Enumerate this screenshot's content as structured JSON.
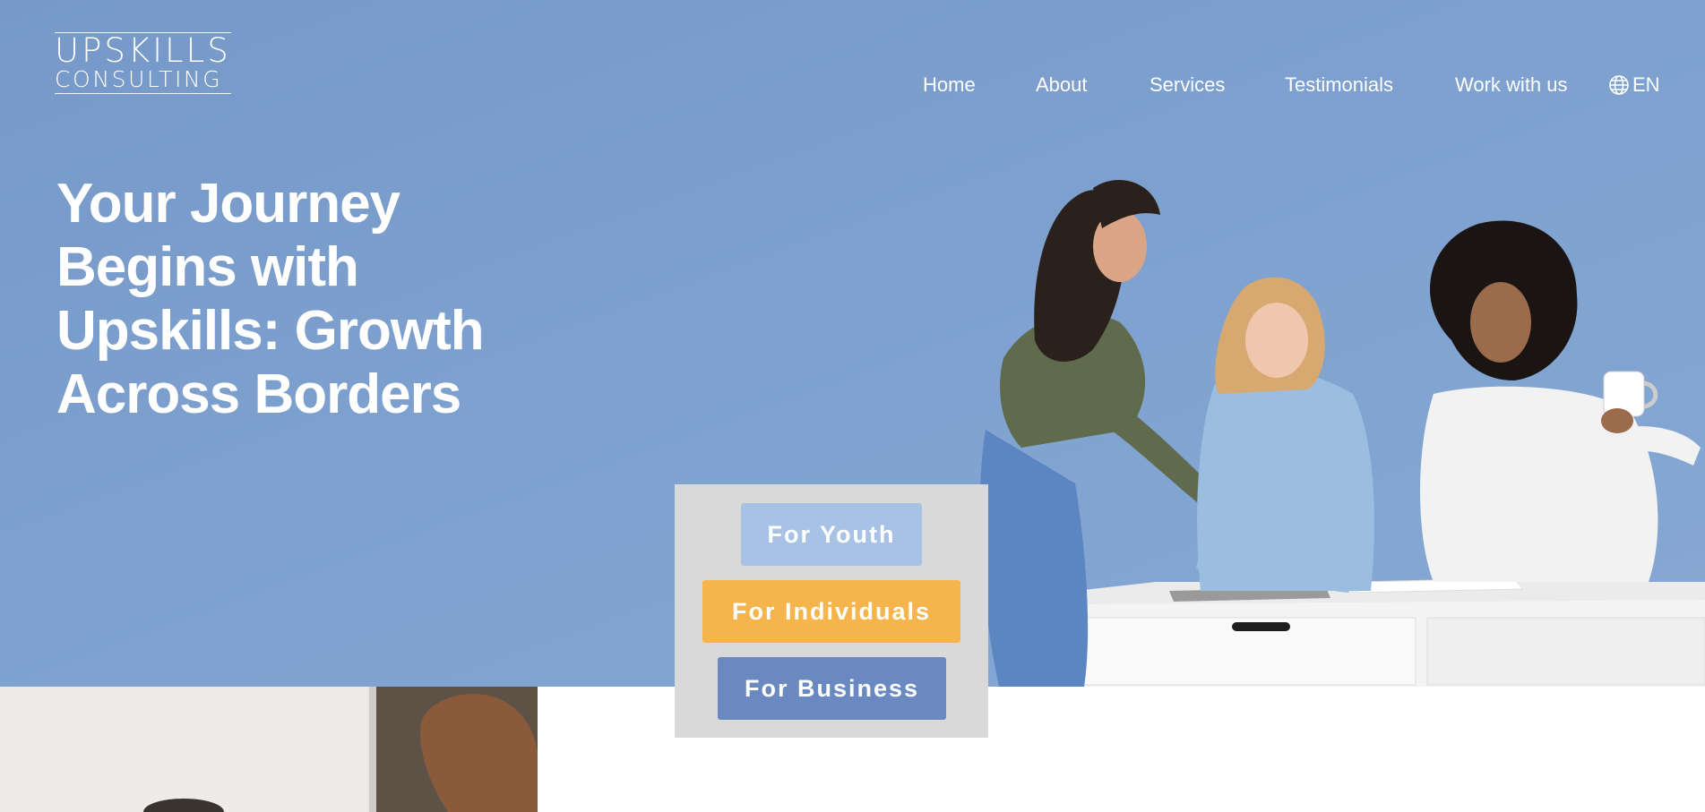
{
  "brand": {
    "logo_line1": "UPSKILLS",
    "logo_line2": "CONSULTING"
  },
  "nav": {
    "items": [
      {
        "label": "Home"
      },
      {
        "label": "About"
      },
      {
        "label": "Services"
      },
      {
        "label": "Testimonials"
      },
      {
        "label": "Work with us"
      }
    ],
    "language": {
      "icon": "globe-icon",
      "label": "EN"
    }
  },
  "hero": {
    "headline": "Your Journey Begins with Upskills: Growth Across Borders"
  },
  "audience": {
    "youth_label": "For Youth",
    "individuals_label": "For Individuals",
    "business_label": "For Business"
  },
  "colors": {
    "hero_bg": "#7ea1d0",
    "youth": "#a8c2e5",
    "individuals": "#f5b44c",
    "business": "#6a89c1",
    "panel": "#d9d9d9"
  }
}
